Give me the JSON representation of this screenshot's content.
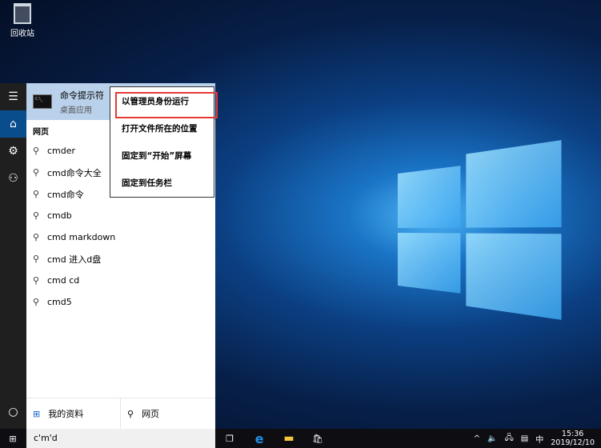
{
  "desktop": {
    "recycle_bin": "回收站"
  },
  "start": {
    "best_match": {
      "title": "命令提示符",
      "subtitle": "桌面应用"
    },
    "section": "网页",
    "suggestions": [
      "cmder",
      "cmd命令大全",
      "cmd命令",
      "cmdb",
      "cmd markdown",
      "cmd 进入d盘",
      "cmd cd",
      "cmd5"
    ],
    "bottom": {
      "profile": "我的资料",
      "web": "网页"
    }
  },
  "context_menu": [
    "以管理员身份运行",
    "打开文件所在的位置",
    "固定到“开始”屏幕",
    "固定到任务栏"
  ],
  "taskbar": {
    "search_value": "c'm'd",
    "ime": "中",
    "time": "15:36",
    "date": "2019/12/10"
  }
}
